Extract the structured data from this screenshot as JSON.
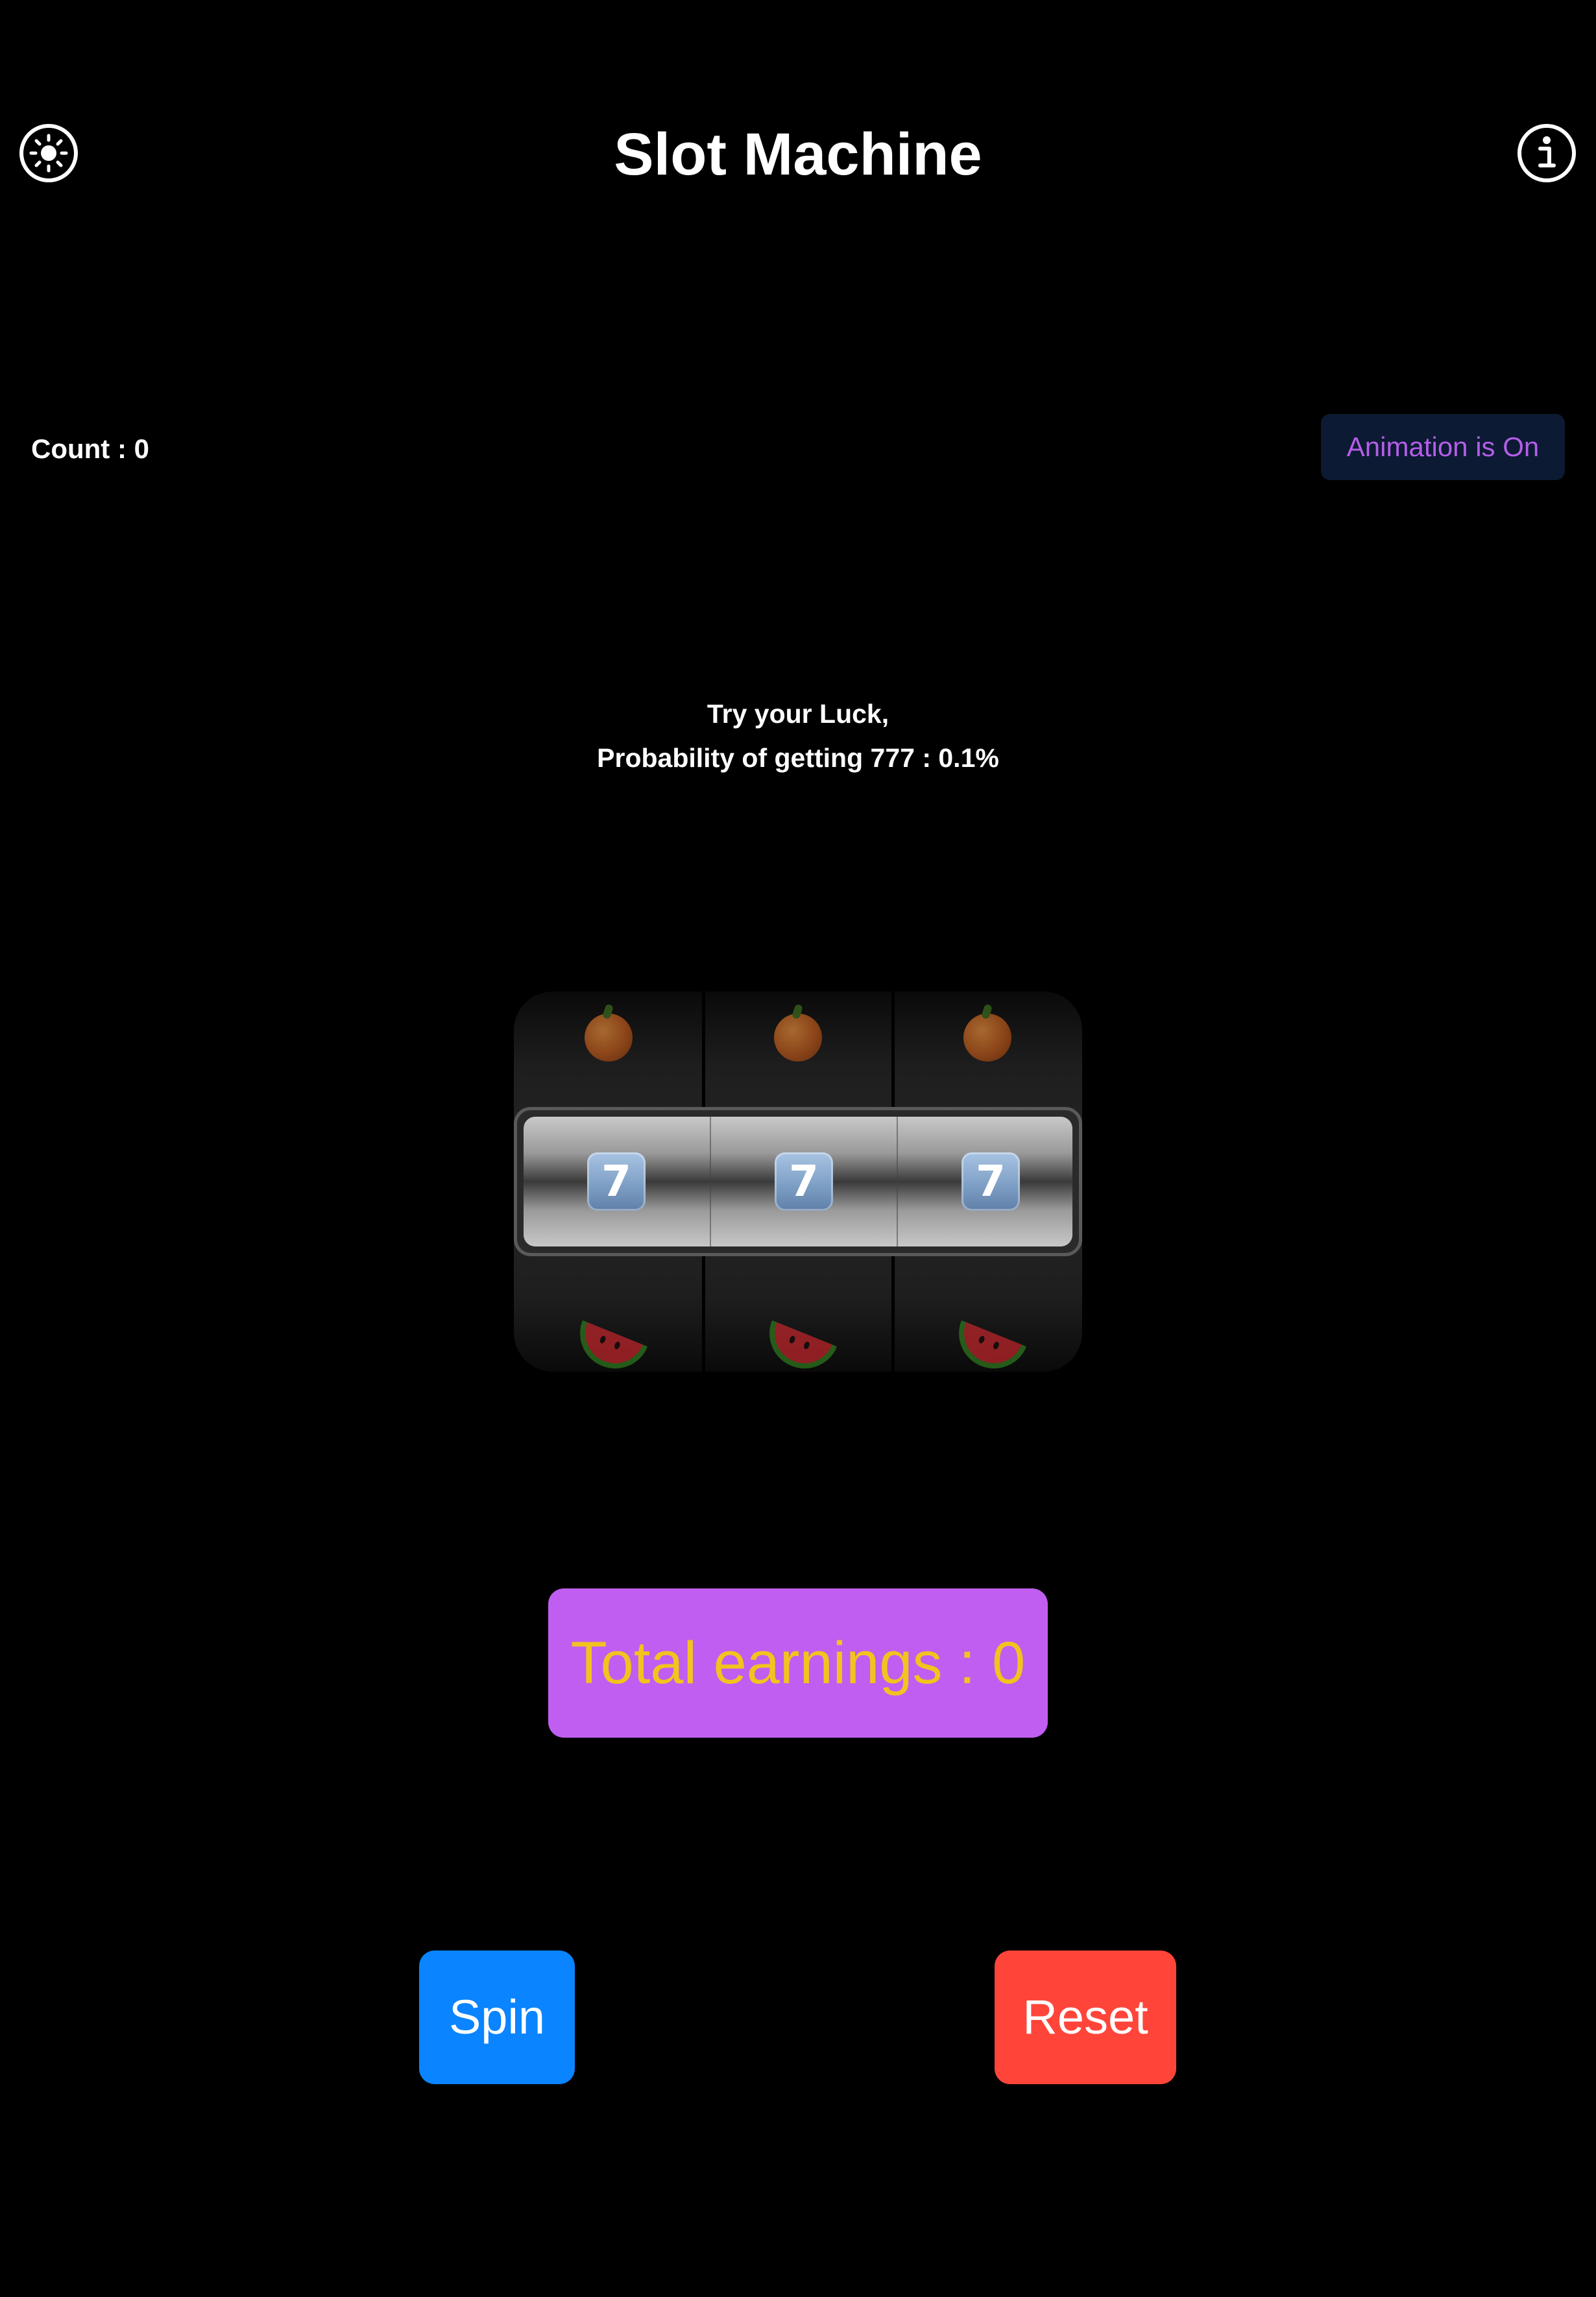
{
  "header": {
    "title": "Slot Machine",
    "theme_icon": "sun-icon",
    "info_icon": "info-icon"
  },
  "status": {
    "count_label": "Count : 0",
    "animation_toggle_label": "Animation is On"
  },
  "prompt": {
    "line1": "Try your Luck,",
    "line2": "Probability of getting 777 : 0.1%"
  },
  "reels": [
    {
      "top": "orange",
      "center": "7",
      "bottom": "watermelon"
    },
    {
      "top": "orange",
      "center": "7",
      "bottom": "watermelon"
    },
    {
      "top": "orange",
      "center": "7",
      "bottom": "watermelon"
    }
  ],
  "earnings": {
    "label": "Total earnings : 0"
  },
  "actions": {
    "spin_label": "Spin",
    "reset_label": "Reset"
  },
  "colors": {
    "background": "#000000",
    "spin": "#0a84ff",
    "reset": "#ff453a",
    "earnings_bg": "#bf5ef0",
    "earnings_text": "#f4c21f",
    "toggle_bg": "#0c1a33",
    "toggle_text": "#b45ee8"
  }
}
